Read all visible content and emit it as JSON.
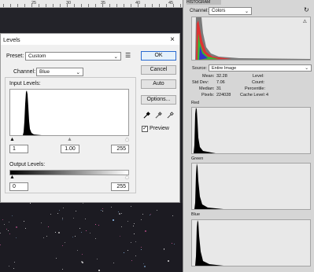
{
  "ruler": {
    "marks": [
      "25",
      "30",
      "35",
      "40",
      "45"
    ]
  },
  "levels": {
    "title": "Levels",
    "close": "×",
    "preset_label": "Preset:",
    "preset_value": "Custom",
    "channel_label": "Channel:",
    "channel_value": "Blue",
    "input_levels_label": "Input Levels:",
    "input_black": "1",
    "input_gamma": "1.00",
    "input_white": "255",
    "output_levels_label": "Output Levels:",
    "output_black": "0",
    "output_white": "255",
    "buttons": {
      "ok": "OK",
      "cancel": "Cancel",
      "auto": "Auto",
      "options": "Options..."
    },
    "preview_label": "Preview",
    "preview_checked": true
  },
  "histogram": {
    "tab_label": "HISTOGRAM",
    "channel_label": "Channel:",
    "channel_value": "Colors",
    "source_label": "Source:",
    "source_value": "Entire Image",
    "stats": {
      "mean_label": "Mean:",
      "mean": "32.28",
      "stddev_label": "Std Dev:",
      "stddev": "7.06",
      "median_label": "Median:",
      "median": "31",
      "pixels_label": "Pixels:",
      "pixels": "224028",
      "level_label": "Level:",
      "count_label": "Count:",
      "percentile_label": "Percentile:",
      "cache_label": "Cache Level:",
      "cache": "4"
    },
    "channels": {
      "red": "Red",
      "green": "Green",
      "blue": "Blue"
    }
  }
}
